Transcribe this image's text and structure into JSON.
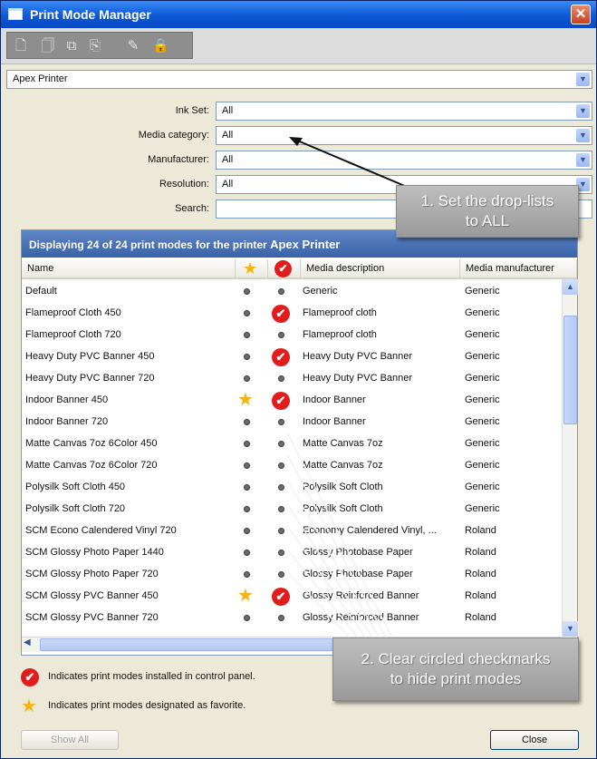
{
  "window": {
    "title": "Print Mode Manager",
    "close_glyph": "✕"
  },
  "toolbar": {
    "icons": [
      "new-document-icon",
      "copy-document-icon",
      "duplicate-icon",
      "export-icon",
      "edit-icon",
      "lock-icon"
    ]
  },
  "printer": {
    "value": "Apex Printer"
  },
  "filters": {
    "ink_set": {
      "label": "Ink Set:",
      "value": "All"
    },
    "media_category": {
      "label": "Media category:",
      "value": "All"
    },
    "manufacturer": {
      "label": "Manufacturer:",
      "value": "All"
    },
    "resolution": {
      "label": "Resolution:",
      "value": "All"
    },
    "search": {
      "label": "Search:",
      "value": ""
    }
  },
  "list": {
    "header_prefix": "Displaying 24 of 24 print modes for the printer",
    "header_printer": "Apex Printer",
    "columns": {
      "name": "Name",
      "media_description": "Media description",
      "media_manufacturer": "Media manufacturer"
    },
    "rows": [
      {
        "name": "Default",
        "media": "Generic",
        "manufacturer": "Generic",
        "favorite": false,
        "installed": false
      },
      {
        "name": "Flameproof Cloth 450",
        "media": "Flameproof cloth",
        "manufacturer": "Generic",
        "favorite": false,
        "installed": true
      },
      {
        "name": "Flameproof Cloth 720",
        "media": "Flameproof cloth",
        "manufacturer": "Generic",
        "favorite": false,
        "installed": false
      },
      {
        "name": "Heavy Duty PVC Banner 450",
        "media": "Heavy Duty PVC Banner",
        "manufacturer": "Generic",
        "favorite": false,
        "installed": true
      },
      {
        "name": "Heavy Duty PVC Banner 720",
        "media": "Heavy Duty PVC Banner",
        "manufacturer": "Generic",
        "favorite": false,
        "installed": false
      },
      {
        "name": "Indoor Banner 450",
        "media": "Indoor Banner",
        "manufacturer": "Generic",
        "favorite": true,
        "installed": true
      },
      {
        "name": "Indoor Banner 720",
        "media": "Indoor Banner",
        "manufacturer": "Generic",
        "favorite": false,
        "installed": false
      },
      {
        "name": "Matte Canvas 7oz 6Color 450",
        "media": "Matte Canvas 7oz",
        "manufacturer": "Generic",
        "favorite": false,
        "installed": false
      },
      {
        "name": "Matte Canvas 7oz 6Color 720",
        "media": "Matte Canvas 7oz",
        "manufacturer": "Generic",
        "favorite": false,
        "installed": false
      },
      {
        "name": "Polysilk Soft Cloth 450",
        "media": "Polysilk Soft Cloth",
        "manufacturer": "Generic",
        "favorite": false,
        "installed": false
      },
      {
        "name": "Polysilk Soft Cloth 720",
        "media": "Polysilk Soft Cloth",
        "manufacturer": "Generic",
        "favorite": false,
        "installed": false
      },
      {
        "name": "SCM Econo Calendered Vinyl 720",
        "media": "Economy Calendered Vinyl, ...",
        "manufacturer": "Roland",
        "favorite": false,
        "installed": false
      },
      {
        "name": "SCM Glossy Photo Paper 1440",
        "media": "Glossy Photobase Paper",
        "manufacturer": "Roland",
        "favorite": false,
        "installed": false
      },
      {
        "name": "SCM Glossy Photo Paper 720",
        "media": "Glossy Photobase Paper",
        "manufacturer": "Roland",
        "favorite": false,
        "installed": false
      },
      {
        "name": "SCM Glossy PVC Banner 450",
        "media": "Glossy Reinforced Banner",
        "manufacturer": "Roland",
        "favorite": true,
        "installed": true
      },
      {
        "name": "SCM Glossy PVC Banner 720",
        "media": "Glossy Reinforced Banner",
        "manufacturer": "Roland",
        "favorite": false,
        "installed": false
      }
    ]
  },
  "legend": {
    "installed": "Indicates print modes installed in control panel.",
    "favorite": "Indicates print modes designated as favorite."
  },
  "buttons": {
    "show_all": "Show All",
    "close": "Close"
  },
  "callouts": {
    "one_line1": "1. Set the drop-lists",
    "one_line2": "to ALL",
    "two_line1": "2. Clear circled checkmarks",
    "two_line2": "to hide print modes"
  },
  "colors": {
    "check": "#e21b1b",
    "star": "#f5b50d",
    "title_bar": "#0b58d6"
  }
}
